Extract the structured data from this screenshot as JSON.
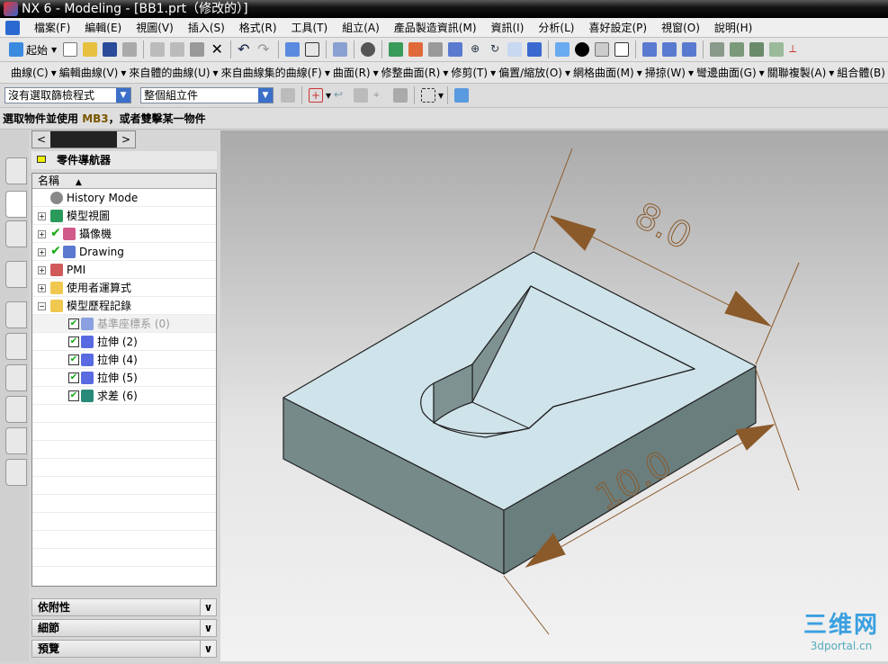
{
  "window": {
    "title": "NX 6 - Modeling - [BB1.prt（修改的）]"
  },
  "menu": [
    "檔案(F)",
    "編輯(E)",
    "視圖(V)",
    "插入(S)",
    "格式(R)",
    "工具(T)",
    "組立(A)",
    "產品製造資訊(M)",
    "資訊(I)",
    "分析(L)",
    "喜好設定(P)",
    "視窗(O)",
    "說明(H)"
  ],
  "toolbar": {
    "start_label": "起始"
  },
  "curve_toolbar": [
    "曲線(C)",
    "編輯曲線(V)",
    "來自體的曲線(U)",
    "來自曲線集的曲線(F)",
    "曲面(R)",
    "修整曲面(R)",
    "修剪(T)",
    "偏置/縮放(O)",
    "網格曲面(M)",
    "掃掠(W)",
    "彎邊曲面(G)",
    "關聯複製(A)",
    "組合體(B)"
  ],
  "selection": {
    "filter": "沒有選取篩檢程式",
    "scope": "整個組立件"
  },
  "status": {
    "prefix": "選取物件並使用 ",
    "mb": "MB3",
    "suffix": "，或者雙擊某一物件"
  },
  "navigator": {
    "title": "零件導航器",
    "column": "名稱",
    "items": [
      {
        "label": "History Mode",
        "icon": "clock-icon"
      },
      {
        "label": "模型視圖",
        "icon": "model-view-icon"
      },
      {
        "label": "攝像機",
        "icon": "camera-icon",
        "checked": true
      },
      {
        "label": "Drawing",
        "icon": "drawing-icon",
        "checked": true
      },
      {
        "label": "PMI",
        "icon": "pmi-icon"
      },
      {
        "label": "使用者運算式",
        "icon": "folder-icon"
      },
      {
        "label": "模型歷程記錄",
        "icon": "folder-icon"
      },
      {
        "label": "基準座標系 (0)",
        "icon": "datum-csys-icon",
        "checked": true
      },
      {
        "label": "拉伸 (2)",
        "icon": "extrude-icon",
        "checked": true
      },
      {
        "label": "拉伸 (4)",
        "icon": "extrude-icon",
        "checked": true
      },
      {
        "label": "拉伸 (5)",
        "icon": "extrude-icon",
        "checked": true
      },
      {
        "label": "求差 (6)",
        "icon": "subtract-icon",
        "checked": true
      }
    ]
  },
  "panels": [
    "依附性",
    "細節",
    "預覽"
  ],
  "dimensions": {
    "width": "8.0",
    "length": "10.0"
  },
  "watermark": {
    "cn": "三维网",
    "url": "3dportal.cn"
  },
  "colors": {
    "face": "#cfe3ea",
    "side": "#6e8585",
    "dimension": "#8b5a2b"
  }
}
